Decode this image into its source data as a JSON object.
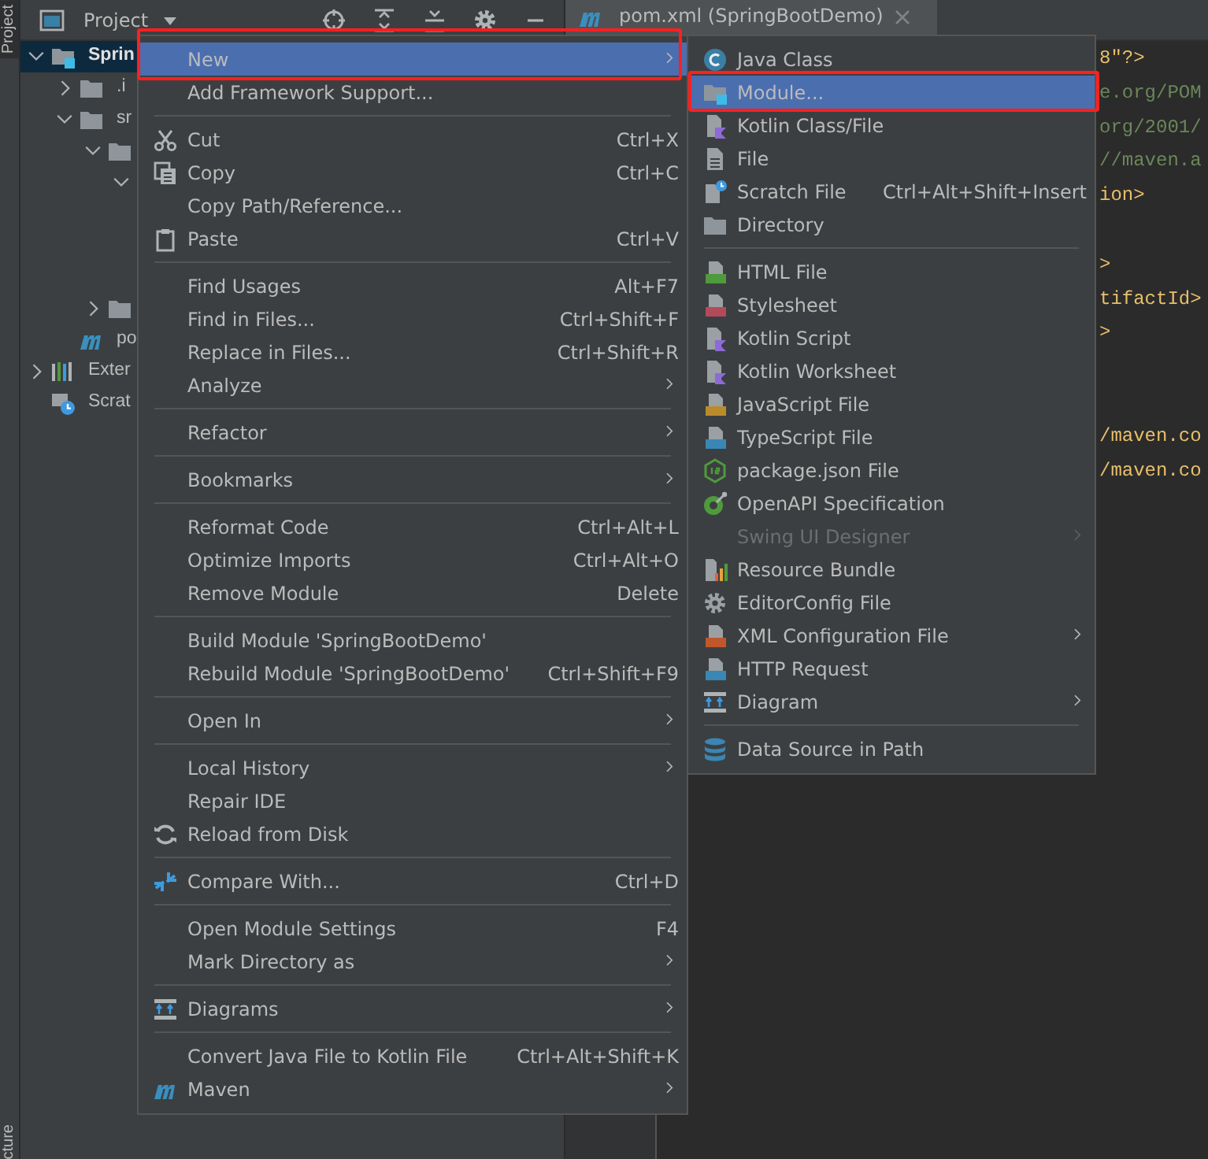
{
  "tool_strip": {
    "top_label": "Project",
    "bottom_label": "cture"
  },
  "project_panel": {
    "title": "Project",
    "tree": [
      {
        "label": "Sprin",
        "kind": "module",
        "expanded": true,
        "selected": true,
        "children": [
          {
            "label": ".i",
            "kind": "folder",
            "expanded": false,
            "selected": false
          },
          {
            "label": "sr",
            "kind": "folder",
            "expanded": true,
            "selected": false,
            "children": [
              {
                "kind": "folder",
                "expanded": true,
                "selected": false,
                "children": [
                  {
                    "expanded": true,
                    "selected": false
                  }
                ]
              },
              {
                "kind": "folder",
                "expanded": false,
                "selected": false
              }
            ]
          },
          {
            "label": "po",
            "kind": "maven",
            "selected": false
          }
        ]
      },
      {
        "label": "Exter",
        "kind": "libraries",
        "expanded": false,
        "selected": false
      },
      {
        "label": "Scrat",
        "kind": "scratches",
        "selected": false
      }
    ]
  },
  "editor": {
    "tab": {
      "title": "pom.xml (SpringBootDemo)"
    },
    "lines": [
      {
        "text": "8\"?>",
        "kind": "tag"
      },
      {
        "text": "e.org/POM",
        "kind": "value"
      },
      {
        "text": "org/2001/",
        "kind": "value"
      },
      {
        "text": "//maven.a",
        "kind": "value"
      },
      {
        "text": "ion>",
        "kind": "tag"
      },
      {
        "kind": "blank"
      },
      {
        "text": ">",
        "kind": "tag"
      },
      {
        "text": "tifactId>",
        "kind": "tag"
      },
      {
        "text": ">",
        "kind": "tag"
      },
      {
        "kind": "blank"
      },
      {
        "kind": "blank"
      },
      {
        "text": "/maven.co",
        "kind": "tag"
      },
      {
        "text": "/maven.co",
        "kind": "tag"
      }
    ]
  },
  "context_menu": {
    "groups": [
      [
        {
          "label": "New",
          "kind": "plain",
          "submenu": true,
          "selected": true,
          "marked": true,
          "disabled": false
        },
        {
          "label": "Add Framework Support...",
          "kind": "plain",
          "submenu": false,
          "selected": false,
          "marked": false,
          "disabled": false
        }
      ],
      [
        {
          "label": "Cut",
          "shortcut": "Ctrl+X",
          "kind": "scissors",
          "submenu": false,
          "selected": false,
          "marked": false,
          "disabled": false
        },
        {
          "label": "Copy",
          "shortcut": "Ctrl+C",
          "kind": "copy",
          "submenu": false,
          "selected": false,
          "marked": false,
          "disabled": false
        },
        {
          "label": "Copy Path/Reference...",
          "kind": "plain",
          "submenu": false,
          "selected": false,
          "marked": false,
          "disabled": false
        },
        {
          "label": "Paste",
          "shortcut": "Ctrl+V",
          "kind": "clipboard",
          "submenu": false,
          "selected": false,
          "marked": false,
          "disabled": false
        }
      ],
      [
        {
          "label": "Find Usages",
          "shortcut": "Alt+F7",
          "kind": "plain",
          "submenu": false,
          "selected": false,
          "marked": false,
          "disabled": false
        },
        {
          "label": "Find in Files...",
          "shortcut": "Ctrl+Shift+F",
          "kind": "plain",
          "submenu": false,
          "selected": false,
          "marked": false,
          "disabled": false
        },
        {
          "label": "Replace in Files...",
          "shortcut": "Ctrl+Shift+R",
          "kind": "plain",
          "submenu": false,
          "selected": false,
          "marked": false,
          "disabled": false
        },
        {
          "label": "Analyze",
          "kind": "plain",
          "submenu": true,
          "selected": false,
          "marked": false,
          "disabled": false
        }
      ],
      [
        {
          "label": "Refactor",
          "kind": "plain",
          "submenu": true,
          "selected": false,
          "marked": false,
          "disabled": false
        }
      ],
      [
        {
          "label": "Bookmarks",
          "kind": "plain",
          "submenu": true,
          "selected": false,
          "marked": false,
          "disabled": false
        }
      ],
      [
        {
          "label": "Reformat Code",
          "shortcut": "Ctrl+Alt+L",
          "kind": "plain",
          "submenu": false,
          "selected": false,
          "marked": false,
          "disabled": false
        },
        {
          "label": "Optimize Imports",
          "shortcut": "Ctrl+Alt+O",
          "kind": "plain",
          "submenu": false,
          "selected": false,
          "marked": false,
          "disabled": false
        },
        {
          "label": "Remove Module",
          "shortcut": "Delete",
          "kind": "plain",
          "submenu": false,
          "selected": false,
          "marked": false,
          "disabled": false
        }
      ],
      [
        {
          "label": "Build Module 'SpringBootDemo'",
          "kind": "plain",
          "submenu": false,
          "selected": false,
          "marked": false,
          "disabled": false
        },
        {
          "label": "Rebuild Module 'SpringBootDemo'",
          "shortcut": "Ctrl+Shift+F9",
          "kind": "plain",
          "submenu": false,
          "selected": false,
          "marked": false,
          "disabled": false
        }
      ],
      [
        {
          "label": "Open In",
          "kind": "plain",
          "submenu": true,
          "selected": false,
          "marked": false,
          "disabled": false
        }
      ],
      [
        {
          "label": "Local History",
          "kind": "plain",
          "submenu": true,
          "selected": false,
          "marked": false,
          "disabled": false
        },
        {
          "label": "Repair IDE",
          "kind": "plain",
          "submenu": false,
          "selected": false,
          "marked": false,
          "disabled": false
        },
        {
          "label": "Reload from Disk",
          "kind": "reload",
          "submenu": false,
          "selected": false,
          "marked": false,
          "disabled": false
        }
      ],
      [
        {
          "label": "Compare With...",
          "shortcut": "Ctrl+D",
          "kind": "compare",
          "submenu": false,
          "selected": false,
          "marked": false,
          "disabled": false
        }
      ],
      [
        {
          "label": "Open Module Settings",
          "shortcut": "F4",
          "kind": "plain",
          "submenu": false,
          "selected": false,
          "marked": false,
          "disabled": false
        },
        {
          "label": "Mark Directory as",
          "kind": "plain",
          "submenu": true,
          "selected": false,
          "marked": false,
          "disabled": false
        }
      ],
      [
        {
          "label": "Diagrams",
          "kind": "diagram",
          "submenu": true,
          "selected": false,
          "marked": false,
          "disabled": false
        }
      ],
      [
        {
          "label": "Convert Java File to Kotlin File",
          "shortcut": "Ctrl+Alt+Shift+K",
          "kind": "plain",
          "submenu": false,
          "selected": false,
          "marked": false,
          "disabled": false
        },
        {
          "label": "Maven",
          "kind": "maven",
          "submenu": true,
          "selected": false,
          "marked": false,
          "disabled": false
        }
      ]
    ]
  },
  "new_submenu": {
    "groups": [
      [
        {
          "label": "Java Class",
          "kind": "java-class",
          "submenu": false,
          "selected": false,
          "marked": false,
          "disabled": false
        },
        {
          "label": "Module...",
          "kind": "module",
          "submenu": false,
          "selected": true,
          "marked": true,
          "disabled": false
        },
        {
          "label": "Kotlin Class/File",
          "kind": "kotlin-file",
          "submenu": false,
          "selected": false,
          "marked": false,
          "disabled": false
        },
        {
          "label": "File",
          "kind": "file",
          "submenu": false,
          "selected": false,
          "marked": false,
          "disabled": false
        },
        {
          "label": "Scratch File",
          "shortcut": "Ctrl+Alt+Shift+Insert",
          "kind": "scratch",
          "submenu": false,
          "selected": false,
          "marked": false,
          "disabled": false
        },
        {
          "label": "Directory",
          "kind": "folder",
          "submenu": false,
          "selected": false,
          "marked": false,
          "disabled": false
        }
      ],
      [
        {
          "label": "HTML File",
          "kind": "html",
          "submenu": false,
          "selected": false,
          "marked": false,
          "disabled": false
        },
        {
          "label": "Stylesheet",
          "kind": "css",
          "submenu": false,
          "selected": false,
          "marked": false,
          "disabled": false
        },
        {
          "label": "Kotlin Script",
          "kind": "kotlin-file",
          "submenu": false,
          "selected": false,
          "marked": false,
          "disabled": false
        },
        {
          "label": "Kotlin Worksheet",
          "kind": "kotlin-file",
          "submenu": false,
          "selected": false,
          "marked": false,
          "disabled": false
        },
        {
          "label": "JavaScript File",
          "kind": "js",
          "submenu": false,
          "selected": false,
          "marked": false,
          "disabled": false
        },
        {
          "label": "TypeScript File",
          "kind": "ts",
          "submenu": false,
          "selected": false,
          "marked": false,
          "disabled": false
        },
        {
          "label": "package.json File",
          "kind": "node",
          "submenu": false,
          "selected": false,
          "marked": false,
          "disabled": false
        },
        {
          "label": "OpenAPI Specification",
          "kind": "openapi",
          "submenu": false,
          "selected": false,
          "marked": false,
          "disabled": false
        },
        {
          "label": "Swing UI Designer",
          "kind": "plain",
          "submenu": true,
          "selected": false,
          "marked": false,
          "disabled": true
        },
        {
          "label": "Resource Bundle",
          "kind": "bundle",
          "submenu": false,
          "selected": false,
          "marked": false,
          "disabled": false
        },
        {
          "label": "EditorConfig File",
          "kind": "gear",
          "submenu": false,
          "selected": false,
          "marked": false,
          "disabled": false
        },
        {
          "label": "XML Configuration File",
          "kind": "xml",
          "submenu": true,
          "selected": false,
          "marked": false,
          "disabled": false
        },
        {
          "label": "HTTP Request",
          "kind": "api",
          "submenu": false,
          "selected": false,
          "marked": false,
          "disabled": false
        },
        {
          "label": "Diagram",
          "kind": "diagram",
          "submenu": true,
          "selected": false,
          "marked": false,
          "disabled": false
        }
      ],
      [
        {
          "label": "Data Source in Path",
          "kind": "database",
          "submenu": false,
          "selected": false,
          "marked": false,
          "disabled": false
        }
      ]
    ]
  }
}
